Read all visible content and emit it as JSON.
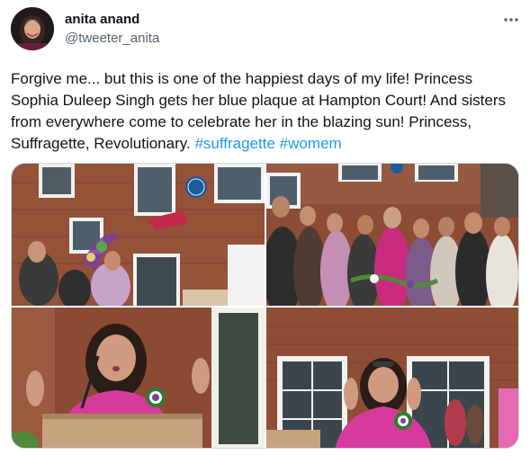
{
  "tweet": {
    "author": {
      "name": "anita anand",
      "handle": "@tweeter_anita"
    },
    "more_icon": "ellipsis-icon",
    "text": "Forgive me... but this is one of the happiest days of my life! Princess Sophia Duleep Singh gets her blue plaque at Hampton Court! And sisters from everywhere come to celebrate her in the blazing sun! Princess, Suffragette, Revolutionary.",
    "hashtags": [
      "#suffragette",
      "#womem"
    ],
    "media": {
      "photos": [
        {
          "subject": "brick building with blue plaque and celebration"
        },
        {
          "subject": "large group of women posing in the sun"
        },
        {
          "subject": "woman speaking at lectern with sash"
        },
        {
          "subject": "woman raising fists in front of brick building"
        }
      ]
    },
    "colors": {
      "text": "#0f1419",
      "secondary": "#536471",
      "link": "#1d9bf0",
      "border": "#cfd9de"
    }
  }
}
